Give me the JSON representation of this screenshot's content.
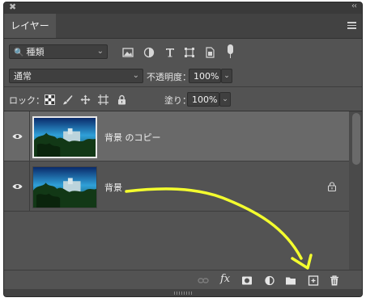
{
  "panel": {
    "tab_label": "レイヤー",
    "titlebar": {
      "close_glyph": "✖",
      "collapse_glyph": "‹‹"
    }
  },
  "filter": {
    "kind_select": "種類",
    "icons": [
      "image-filter-icon",
      "adjustment-filter-icon",
      "text-filter-icon",
      "shape-filter-icon",
      "smart-object-filter-icon",
      "filter-toggle-icon"
    ]
  },
  "blend": {
    "mode": "通常",
    "opacity_label": "不透明度：",
    "opacity_value": "100%"
  },
  "lock": {
    "label": "ロック：",
    "icons": [
      "lock-transparent-pixels-icon",
      "lock-image-pixels-icon",
      "lock-position-icon",
      "lock-artboard-icon",
      "lock-all-icon"
    ],
    "fill_label": "塗り：",
    "fill_value": "100%"
  },
  "layers": [
    {
      "name": "背景 のコピー",
      "selected": true,
      "visible": true,
      "locked": false
    },
    {
      "name": "背景",
      "selected": false,
      "visible": true,
      "locked": true
    }
  ],
  "annotation": {
    "color": "#f4ff2e"
  },
  "footer": {
    "icons": [
      "link-layers-icon",
      "layer-style-fx-icon",
      "add-mask-icon",
      "adjustment-layer-icon",
      "new-group-folder-icon",
      "new-layer-icon",
      "delete-layer-trash-icon"
    ],
    "fx_text": "fx"
  },
  "colors": {
    "panel_bg": "#535353",
    "selected_row": "#696969",
    "annotation": "#f4ff2e"
  }
}
